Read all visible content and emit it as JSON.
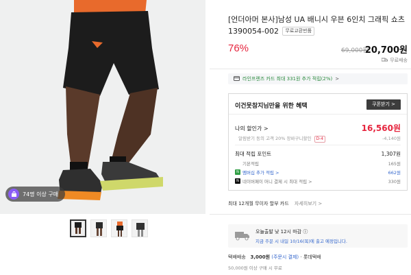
{
  "product": {
    "title": "[언더아머 본사]남성 UA 배니시 우븐 6인치 그래픽 쇼츠1390054-002",
    "tag": "무료교환반품",
    "discount": "76%",
    "original_price": "69,000원",
    "price": "20,700원",
    "shipping_free": "무료배송"
  },
  "gallery": {
    "buyer_badge": "74명 이상 구매",
    "thumbnail_count": 4,
    "active_thumbnail": 1
  },
  "card_banner": {
    "text": "라인프렌즈 카드 최대 331원 추가 적립(2%)",
    "chevron": ">"
  },
  "benefit": {
    "title": "이건못참지님만을 위한 혜택",
    "coupon_button": "쿠폰받기 >",
    "my_price_label": "나의 할인가 >",
    "my_price": "16,560원",
    "sub_text": "알림받기 동의 고객 20% 장바구니할인",
    "sub_badge": "D-4",
    "sub_value": "-4,140원",
    "points_label": "최대 적립 포인트",
    "points_total": "1,307원",
    "points": [
      {
        "label": "기본적립",
        "value": "165원",
        "icon": ""
      },
      {
        "label": "멤버십 추가 적립 >",
        "value": "662원",
        "icon": "membership-icon"
      },
      {
        "label": "네이버페이 머니 결제 시 최대 적립 >",
        "value": "330원",
        "icon": "npay-icon"
      }
    ]
  },
  "installment": {
    "text": "최대 12개월 무이자 할부 카드",
    "more": "자세히보기 >"
  },
  "delivery": {
    "title": "오늘출발 낮 12시 마감 ⓘ",
    "subtitle": "지금 주문 시 내일 10/16(목)에 출고 예정입니다.",
    "ship_label": "택배배송",
    "ship_fee": "3,000원",
    "ship_fee_note": "(주문시 결제)",
    "carrier": "· 롯데택배",
    "free_condition": "50,000원 이상 구매 시 무료"
  },
  "colors": {
    "accent_red": "#e6253e",
    "link_blue": "#3366cc",
    "shorts": "#1c1c1c",
    "shoe_orange": "#f08a24",
    "badge_purple": "#8a5cf6"
  }
}
